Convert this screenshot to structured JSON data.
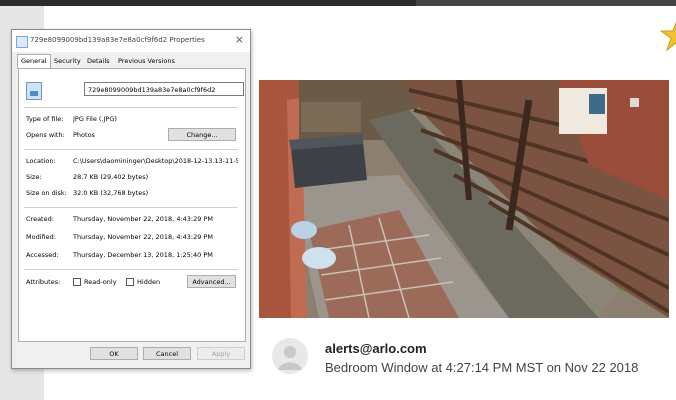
{
  "viewer": {
    "prev_arrow_glyph": "‹"
  },
  "email": {
    "sender": "alerts@arlo.com",
    "subject": "Bedroom Window at 4:27:14 PM MST on Nov 22 2018"
  },
  "dialog": {
    "title": "729e8099009bd139a83e7e8a0cf9f6d2 Properties",
    "close_glyph": "×",
    "tabs": [
      "General",
      "Security",
      "Details",
      "Previous Versions"
    ],
    "file_name": "729e8099009bd139a83e7e8a0cf9f6d2",
    "type_label": "Type of file:",
    "type_value": "JPG File (.JPG)",
    "opens_label": "Opens with:",
    "opens_value": "Photos",
    "change_button": "Change...",
    "location_label": "Location:",
    "location_value": "C:\\Users\\daomininger\\Desktop\\2018-12-13.13-11-5",
    "size_label": "Size:",
    "size_value": "28.7 KB (29,402 bytes)",
    "size_on_disk_label": "Size on disk:",
    "size_on_disk_value": "32.0 KB (32,768 bytes)",
    "created_label": "Created:",
    "created_value": "Thursday, November 22, 2018, 4:43:29 PM",
    "modified_label": "Modified:",
    "modified_value": "Thursday, November 22, 2018, 4:43:29 PM",
    "accessed_label": "Accessed:",
    "accessed_value": "Thursday, December 13, 2018, 1:25:40 PM",
    "attributes_label": "Attributes:",
    "readonly_label": "Read-only",
    "hidden_label": "Hidden",
    "advanced_button": "Advanced...",
    "ok_button": "OK",
    "cancel_button": "Cancel",
    "apply_button": "Apply"
  }
}
